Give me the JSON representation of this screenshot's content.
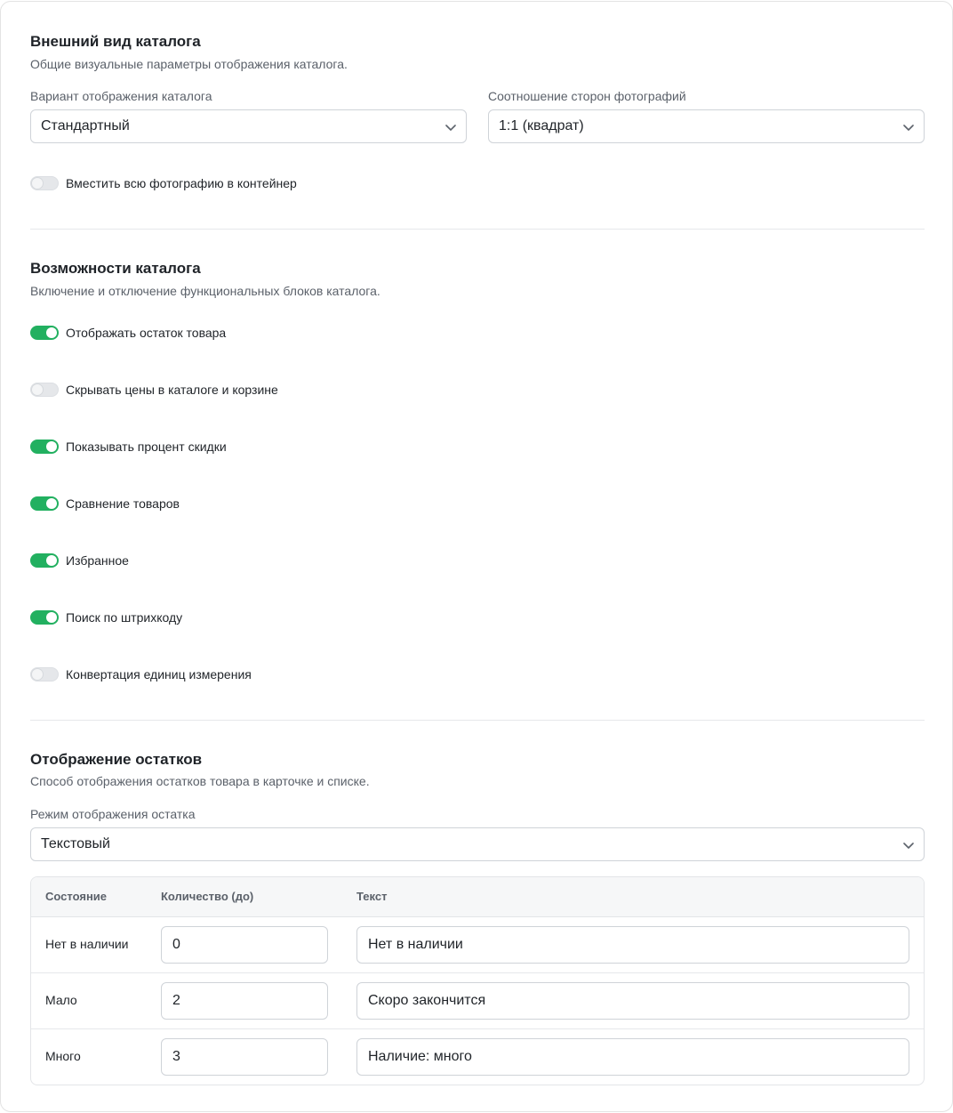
{
  "appearance": {
    "title": "Внешний вид каталога",
    "description": "Общие визуальные параметры отображения каталога.",
    "variant_label": "Вариант отображения каталога",
    "variant_value": "Стандартный",
    "ratio_label": "Соотношение сторон фотографий",
    "ratio_value": "1:1 (квадрат)",
    "fit_toggle": {
      "label": "Вместить всю фотографию в контейнер",
      "on": false
    }
  },
  "features": {
    "title": "Возможности каталога",
    "description": "Включение и отключение функциональных блоков каталога.",
    "toggles": [
      {
        "label": "Отображать остаток товара",
        "on": true
      },
      {
        "label": "Скрывать цены в каталоге и корзине",
        "on": false
      },
      {
        "label": "Показывать процент скидки",
        "on": true
      },
      {
        "label": "Сравнение товаров",
        "on": true
      },
      {
        "label": "Избранное",
        "on": true
      },
      {
        "label": "Поиск по штрихкоду",
        "on": true
      },
      {
        "label": "Конвертация единиц измерения",
        "on": false
      }
    ]
  },
  "stock": {
    "title": "Отображение остатков",
    "description": "Способ отображения остатков товара в карточке и списке.",
    "mode_label": "Режим отображения остатка",
    "mode_value": "Текстовый",
    "table": {
      "headers": [
        "Состояние",
        "Количество (до)",
        "Текст"
      ],
      "rows": [
        {
          "state": "Нет в наличии",
          "qty": "0",
          "text": "Нет в наличии"
        },
        {
          "state": "Мало",
          "qty": "2",
          "text": "Скоро закончится"
        },
        {
          "state": "Много",
          "qty": "3",
          "text": "Наличие: много"
        }
      ]
    }
  },
  "colors": {
    "accent": "#22b060",
    "toggle_off": "#e5e7ea",
    "border": "#cfd3d8"
  }
}
